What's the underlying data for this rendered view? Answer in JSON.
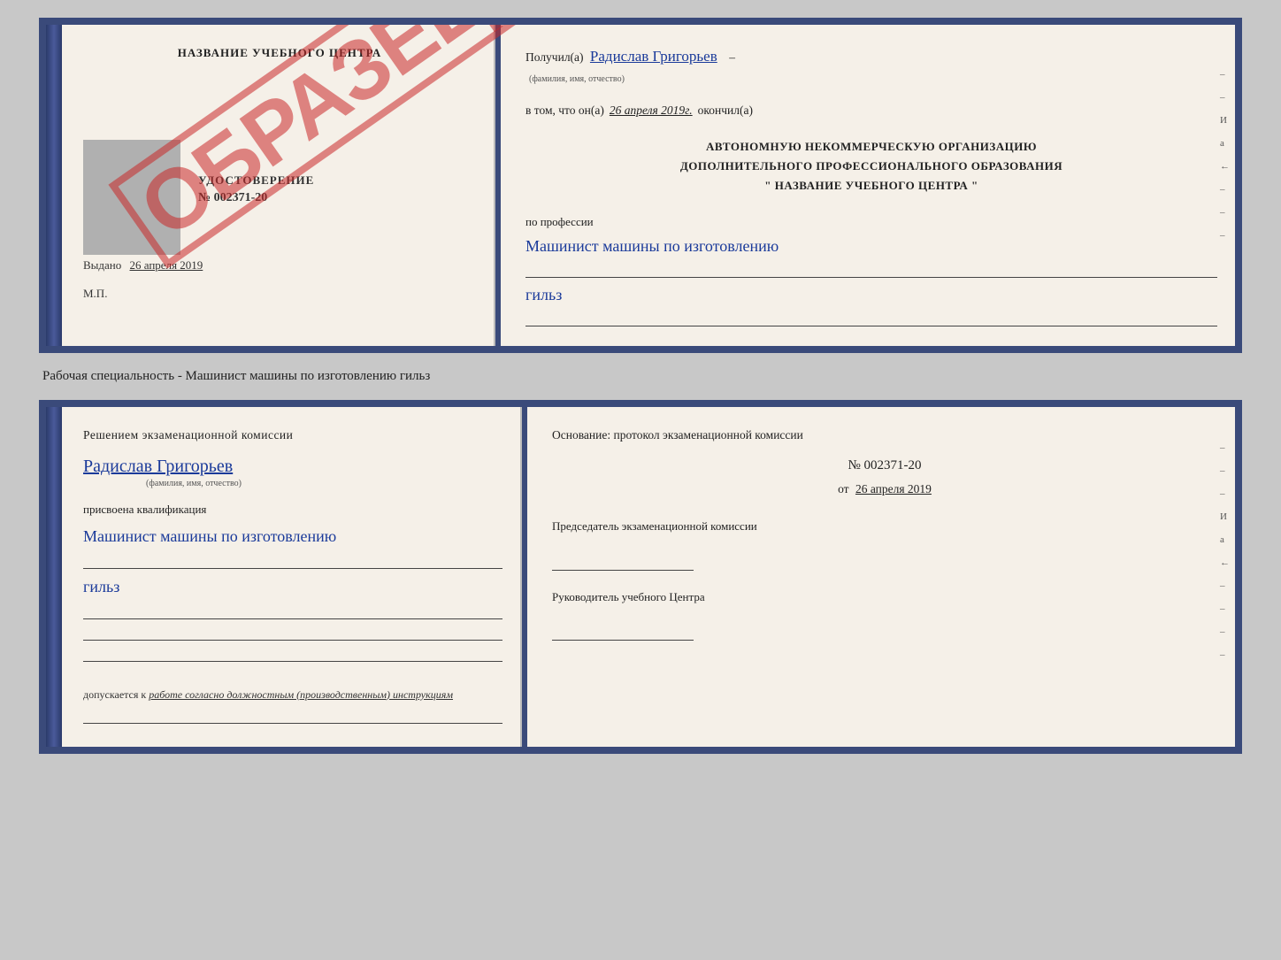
{
  "top_doc": {
    "left": {
      "school_name": "НАЗВАНИЕ УЧЕБНОГО ЦЕНТРА",
      "cert_word": "УДОСТОВЕРЕНИЕ",
      "cert_number": "№ 002371-20",
      "issued_label": "Выдано",
      "issued_date": "26 апреля 2019",
      "mp_label": "М.П."
    },
    "stamp": "ОБРАЗЕЦ",
    "right": {
      "received_prefix": "Получил(а)",
      "received_name": "Радислав Григорьев",
      "fio_hint": "(фамилия, имя, отчество)",
      "date_prefix": "в том, что он(а)",
      "date_value": "26 апреля 2019г.",
      "date_suffix": "окончил(а)",
      "org_line1": "АВТОНОМНУЮ НЕКОММЕРЧЕСКУЮ ОРГАНИЗАЦИЮ",
      "org_line2": "ДОПОЛНИТЕЛЬНОГО ПРОФЕССИОНАЛЬНОГО ОБРАЗОВАНИЯ",
      "org_line3": "\"   НАЗВАНИЕ УЧЕБНОГО ЦЕНТРА   \"",
      "profession_label": "по профессии",
      "profession_cursive": "Машинист машины по изготовлению",
      "profession_cursive2": "гильз",
      "side_marks": [
        "–",
        "–",
        "И",
        "а",
        "←",
        "–",
        "–",
        "–"
      ]
    }
  },
  "between_label": "Рабочая специальность - Машинист машины по изготовлению гильз",
  "bottom_doc": {
    "left": {
      "decision_title": "Решением  экзаменационной  комиссии",
      "person_name": "Радислав Григорьев",
      "fio_sub": "(фамилия, имя, отчество)",
      "assigned_label": "присвоена квалификация",
      "qual_cursive": "Машинист машины по изготовлению",
      "qual_cursive2": "гильз",
      "allowed_prefix": "допускается к",
      "allowed_italic": "работе согласно должностным (производственным) инструкциям"
    },
    "right": {
      "basis_title": "Основание: протокол экзаменационной  комиссии",
      "protocol_number": "№  002371-20",
      "protocol_date_prefix": "от",
      "protocol_date": "26 апреля 2019",
      "chairman_label": "Председатель экзаменационной комиссии",
      "director_label": "Руководитель учебного Центра",
      "side_marks": [
        "–",
        "–",
        "–",
        "И",
        "а",
        "←",
        "–",
        "–",
        "–",
        "–"
      ]
    }
  }
}
